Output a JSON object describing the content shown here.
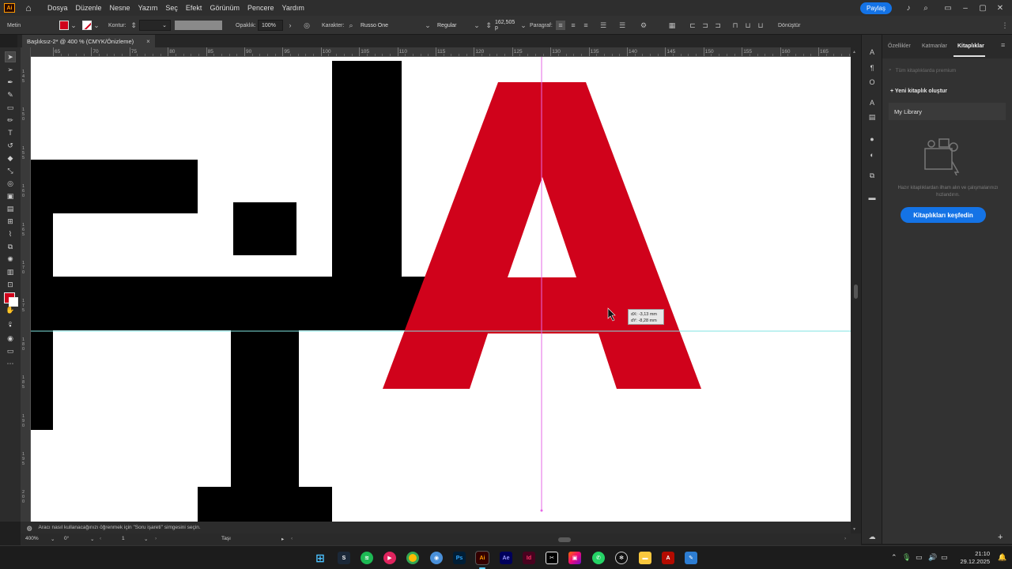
{
  "app": {
    "logo": "Ai",
    "menu": [
      "Dosya",
      "Düzenle",
      "Nesne",
      "Yazım",
      "Seç",
      "Efekt",
      "Görünüm",
      "Pencere",
      "Yardım"
    ],
    "share_label": "Paylaş"
  },
  "control_bar": {
    "mode_label": "Metin",
    "stroke_label": "Kontur:",
    "opacity_label": "Opaklık:",
    "opacity_value": "100%",
    "character_label": "Karakter:",
    "font_family": "Russo One",
    "font_style": "Regular",
    "font_size": "162,505 p",
    "paragraph_label": "Paragraf:",
    "transform_label": "Dönüştür",
    "fill_color": "#d0021b"
  },
  "document": {
    "tab_title": "Başlıksız-2* @ 400 % (CMYK/Önizleme)",
    "close_glyph": "×"
  },
  "ruler": {
    "top_labels": [
      "65",
      "70",
      "75",
      "80",
      "85",
      "90",
      "95",
      "100",
      "105",
      "110",
      "115",
      "120",
      "125",
      "130",
      "135",
      "140",
      "145",
      "150",
      "155",
      "160",
      "165"
    ],
    "left_labels": [
      "1\n4\n5",
      "1\n5\n0",
      "1\n5\n5",
      "1\n6\n0",
      "1\n6\n5",
      "1\n7\n0",
      "1\n7\n5",
      "1\n8\n0",
      "1\n8\n5",
      "1\n9\n0",
      "1\n9\n5",
      "2\n0\n0",
      "2\n0\n5"
    ]
  },
  "canvas": {
    "letter_color": "#d0021b",
    "shape_color": "#000000",
    "guide_color": "#7fe3e0",
    "cursor_guide_color": "#e667e6",
    "tooltip_dx": "dX: -3,13 mm",
    "tooltip_dy": "dY: -8,28 mm"
  },
  "panel": {
    "tabs": [
      "Özellikler",
      "Katmanlar",
      "Kitaplıklar"
    ],
    "active_tab": "Kitaplıklar",
    "search_placeholder": "Tüm kitaplıklarda premium",
    "new_library": "Yeni kitaplık oluştur",
    "library_name": "My Library",
    "help_text": "Hazır kitaplıklardan ilham alın ve çalışmalarınızı hızlandırın.",
    "explore_button": "Kitaplıkları keşfedin"
  },
  "status": {
    "hint": "Aracı nasıl kullanacağınızı öğrenmek için \"Soru işareti\" simgesini seçin.",
    "zoom": "400%",
    "rotation": "0°",
    "artboard": "1",
    "tool_name": "Taşı"
  },
  "taskbar": {
    "time": "21:10",
    "date": "29.12.2025",
    "apps": [
      "windows",
      "steam",
      "spotify",
      "media",
      "chrome",
      "photos",
      "Ps",
      "Ai",
      "Ae",
      "Id",
      "capcut",
      "gallery",
      "whatsapp",
      "chatgpt",
      "explorer",
      "acrobat",
      "paint"
    ]
  }
}
